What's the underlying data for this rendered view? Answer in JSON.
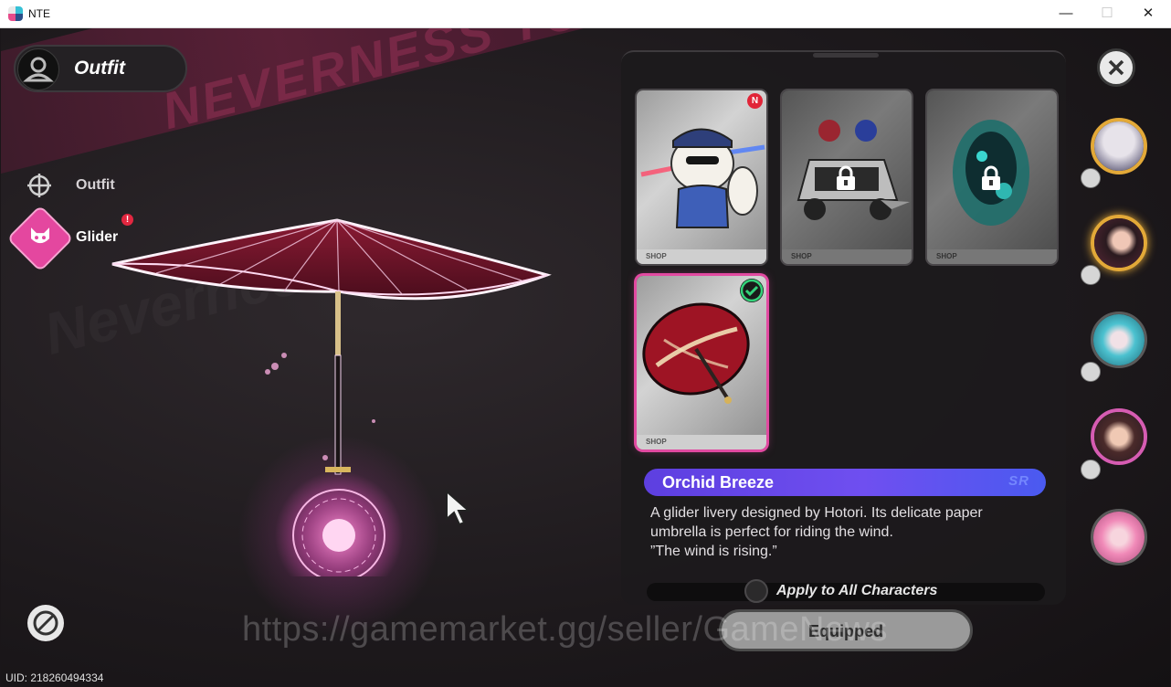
{
  "window": {
    "title": "NTE"
  },
  "header": {
    "title": "Outfit"
  },
  "menu": {
    "items": [
      {
        "label": "Outfit",
        "icon": "crosshair-icon",
        "selected": false
      },
      {
        "label": "Glider",
        "icon": "cat-mask-icon",
        "selected": true,
        "alert": "!"
      }
    ]
  },
  "background": {
    "ribbon_text": "NEVERNESS TO EVERNESS",
    "faint_text": "Neverness"
  },
  "cards": [
    {
      "name": "police-hamster",
      "badge": "N",
      "locked": false,
      "selected": false,
      "footer": "SHOP"
    },
    {
      "name": "police-car",
      "badge": "",
      "locked": true,
      "selected": false,
      "footer": "SHOP"
    },
    {
      "name": "teal-spirit",
      "badge": "",
      "locked": true,
      "selected": false,
      "footer": "SHOP"
    },
    {
      "name": "orchid-umbrella",
      "badge": "check",
      "locked": false,
      "selected": true,
      "footer": "SHOP"
    }
  ],
  "item": {
    "name": "Orchid Breeze",
    "rarity_mark": "SR",
    "description": [
      "A glider livery designed by Hotori. Its delicate paper",
      "umbrella is perfect for riding the wind.",
      "”The wind is rising.”"
    ]
  },
  "apply_all": {
    "label": "Apply to All Characters",
    "checked": false
  },
  "equip_button": {
    "label": "Equipped"
  },
  "uid": "UID: 218260494334",
  "watermark": "https://gamemarket.gg/seller/GameNews",
  "colors": {
    "accent_pink": "#e24aa1",
    "name_bar": "#6f4ff0",
    "avatar_gold": "#e3a938"
  }
}
